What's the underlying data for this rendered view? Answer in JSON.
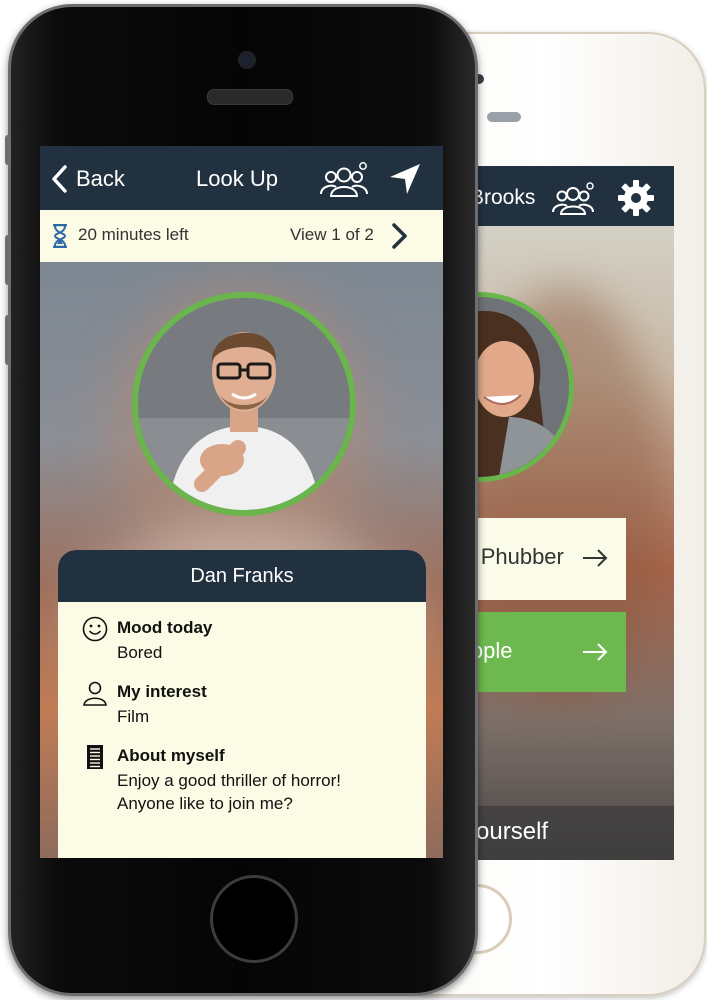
{
  "back_phone": {
    "header_title": "Brooks",
    "card1_text": "e a Phubber",
    "card2_text": "People",
    "footer_text": "s Yourself",
    "icons": {
      "people": "people-group-icon",
      "settings": "gear-icon",
      "arrow": "arrow-right-icon"
    }
  },
  "front_phone": {
    "nav": {
      "back_label": "Back",
      "title": "Look Up"
    },
    "info_bar": {
      "time_left": "20 minutes left",
      "view_count": "View 1 of 2"
    },
    "profile": {
      "name": "Dan Franks",
      "mood_label": "Mood today",
      "mood_value": "Bored",
      "interest_label": "My interest",
      "interest_value": "Film",
      "about_label": "About myself",
      "about_line1": "Enjoy a good thriller of horror!",
      "about_line2": "Anyone like to join me?"
    },
    "icons": {
      "back": "chevron-left-icon",
      "people": "people-group-icon",
      "location": "navigation-arrow-icon",
      "timer": "hourglass-icon",
      "next": "chevron-right-icon",
      "mood": "smiley-icon",
      "interest": "person-outline-icon",
      "about": "notes-icon"
    }
  },
  "colors": {
    "header": "#22313f",
    "accent_green": "#6ab54c",
    "cream": "#fbfbe6",
    "text": "#333333"
  }
}
